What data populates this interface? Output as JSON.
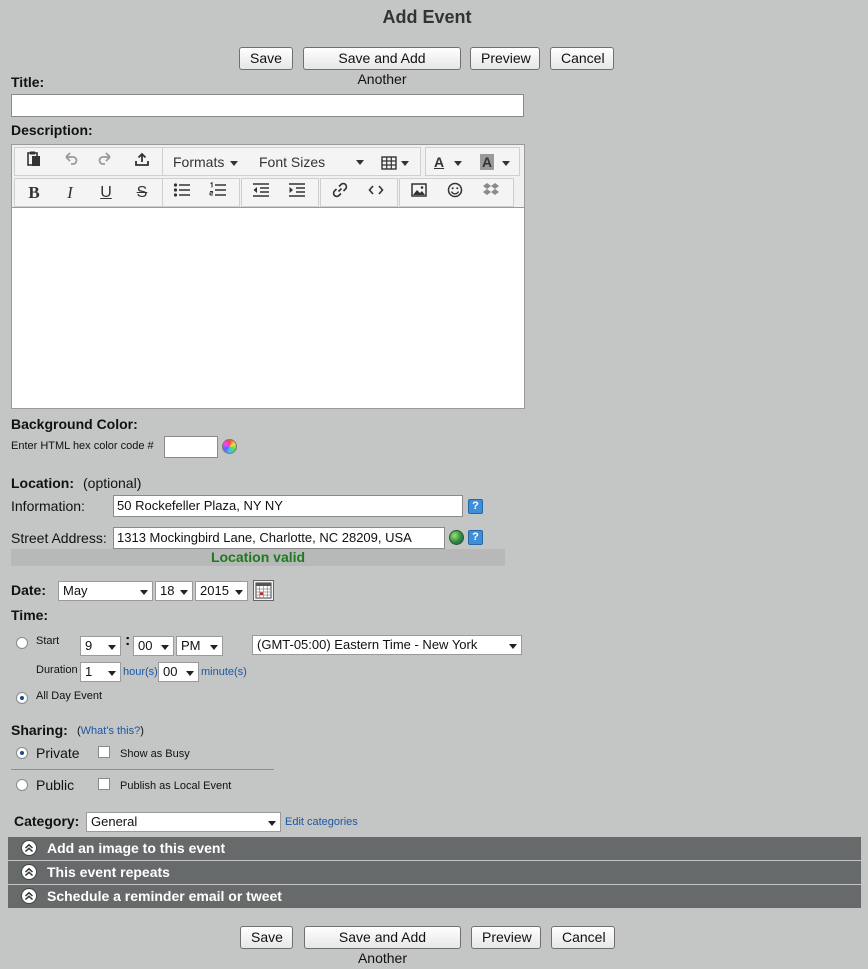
{
  "page_title": "Add Event",
  "buttons": {
    "save": "Save",
    "save_add_another": "Save and Add Another",
    "preview": "Preview",
    "cancel": "Cancel"
  },
  "title_field": {
    "label": "Title:",
    "value": ""
  },
  "description": {
    "label": "Description:",
    "formats_label": "Formats",
    "font_sizes_label": "Font Sizes"
  },
  "background_color": {
    "label": "Background Color:",
    "hint": "Enter HTML hex color code #",
    "value": ""
  },
  "location": {
    "label": "Location:",
    "optional": "(optional)",
    "information_label": "Information:",
    "information_value": "50 Rockefeller Plaza, NY NY",
    "street_label": "Street Address:",
    "street_value": "1313 Mockingbird Lane, Charlotte, NC 28209, USA",
    "status": "Location valid",
    "status_color": "#1d7a1d",
    "help_glyph": "?"
  },
  "date": {
    "label": "Date:",
    "month": "May",
    "day": "18",
    "year": "2015"
  },
  "time": {
    "label": "Time:",
    "start_label": "Start",
    "hour": "9",
    "separator": ":",
    "minute": "00",
    "ampm": "PM",
    "timezone": "(GMT-05:00) Eastern Time - New York",
    "duration_label": "Duration",
    "duration_hours": "1",
    "hours_unit": "hour(s)",
    "duration_minutes": "00",
    "minutes_unit": "minute(s)",
    "all_day_label": "All Day Event",
    "selected": "all_day"
  },
  "sharing": {
    "label": "Sharing:",
    "whats_this_open": "(",
    "whats_this": "What's this?",
    "whats_this_close": ")",
    "private_label": "Private",
    "show_busy_label": "Show as Busy",
    "public_label": "Public",
    "publish_local_label": "Publish as Local Event",
    "selected": "private"
  },
  "category": {
    "label": "Category:",
    "value": "General",
    "edit_link": "Edit categories"
  },
  "sections": [
    {
      "label": "Add an image to this event"
    },
    {
      "label": "This event repeats"
    },
    {
      "label": "Schedule a reminder email or tweet"
    }
  ],
  "colors": {
    "background": "#c4c6c6",
    "accordion": "#666a6a",
    "link": "#1a57a4"
  }
}
